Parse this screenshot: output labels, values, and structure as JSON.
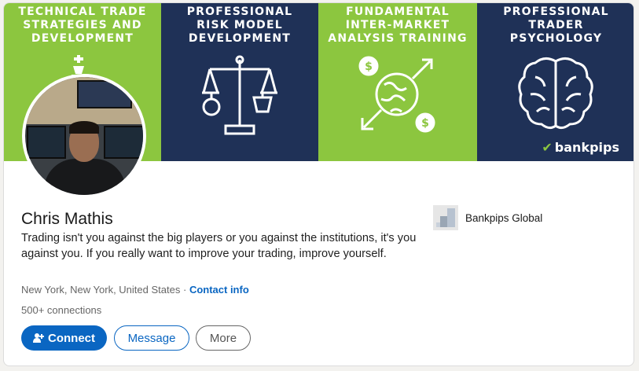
{
  "banner": {
    "panels": [
      {
        "title": "TECHNICAL TRADE\nSTRATEGIES AND\nDEVELOPMENT",
        "icon": "chess-king-icon"
      },
      {
        "title": "PROFESSIONAL\nRISK MODEL\nDEVELOPMENT",
        "icon": "balance-scale-icon"
      },
      {
        "title": "FUNDAMENTAL\nINTER-MARKET\nANALYSIS TRAINING",
        "icon": "globe-dollar-icon"
      },
      {
        "title": "PROFESSIONAL\nTRADER\nPSYCHOLOGY",
        "icon": "brain-icon"
      }
    ],
    "brand": "bankpips",
    "colors": {
      "green": "#8cc63f",
      "navy": "#1f3157"
    }
  },
  "profile": {
    "name": "Chris Mathis",
    "headline": "Trading isn't you against the big players or you against the institutions, it's you against you. If you really want to improve your trading, improve yourself.",
    "location": "New York, New York, United States",
    "separator": "·",
    "contact_label": "Contact info",
    "connections": "500+ connections"
  },
  "actions": {
    "connect": "Connect",
    "message": "Message",
    "more": "More",
    "accent": "#0a66c2"
  },
  "company": {
    "name": "Bankpips Global"
  }
}
